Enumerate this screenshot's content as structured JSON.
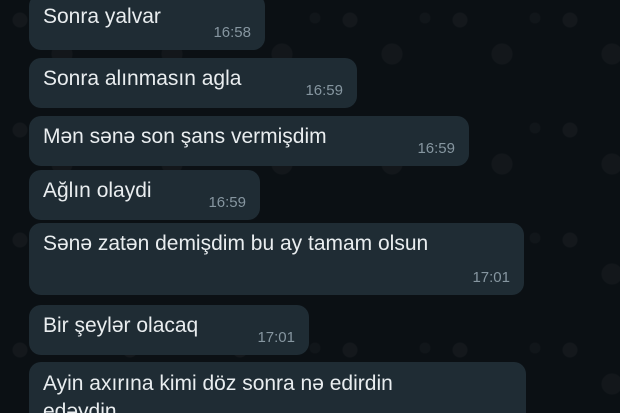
{
  "messages": [
    {
      "text": "Sonra yalvar",
      "time": "16:58"
    },
    {
      "text": "Sonra alınmasın agla",
      "time": "16:59"
    },
    {
      "text": "Mən sənə son şans vermişdim",
      "time": "16:59"
    },
    {
      "text": "Ağlın olaydi",
      "time": "16:59"
    },
    {
      "text": "Sənə zatən demişdim bu ay tamam olsun",
      "time": "17:01"
    },
    {
      "text": "Bir şeylər olacaq",
      "time": "17:01"
    },
    {
      "text": "Ayin axırına kimi döz sonra nə edirdin",
      "text_line2": "edəydin"
    }
  ],
  "colors": {
    "background": "#0b1014",
    "bubble": "#1f2c34",
    "text": "#e9edef",
    "timestamp": "#8696a0"
  }
}
